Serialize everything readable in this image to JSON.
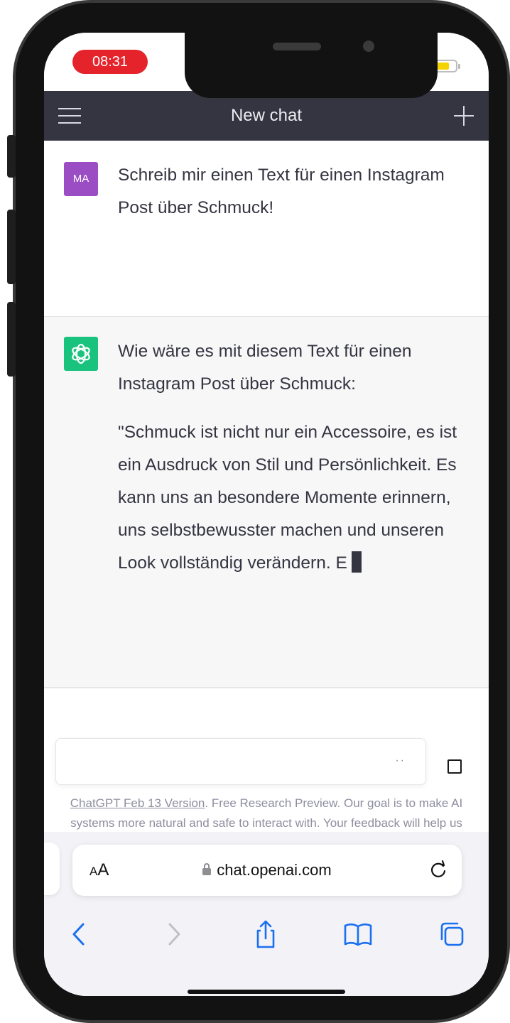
{
  "status_bar": {
    "time": "08:31",
    "accent_color": "#e5232b",
    "battery_color": "#f5d300"
  },
  "chat_header": {
    "title": "New chat",
    "menu_icon": "hamburger-menu-icon",
    "new_chat_icon": "plus-icon"
  },
  "messages": [
    {
      "role": "user",
      "avatar_initials": "MA",
      "avatar_color": "#9b4ec3",
      "text": "Schreib mir einen Text für einen Instagram Post über Schmuck!"
    },
    {
      "role": "assistant",
      "avatar_icon": "openai-logo-icon",
      "avatar_color": "#19c37d",
      "paragraphs": [
        "Wie wäre es mit diesem Text für einen Instagram Post über Schmuck:",
        "\"Schmuck ist nicht nur ein Accessoire, es ist ein Ausdruck von Stil und Persönlichkeit. Es kann uns an besondere Momente erinnern, uns selbstbewusster machen und unseren Look vollständig verändern. E"
      ]
    }
  ],
  "input": {
    "value": "",
    "typing_indicator": "··"
  },
  "footer": {
    "version_link": "ChatGPT Feb 13 Version",
    "note": ". Free Research Preview. Our goal is to make AI systems more natural and safe to interact with. Your feedback will help us improve."
  },
  "browser": {
    "text_size_label": "AA",
    "url": "chat.openai.com",
    "accent_color": "#1a6ff0"
  }
}
